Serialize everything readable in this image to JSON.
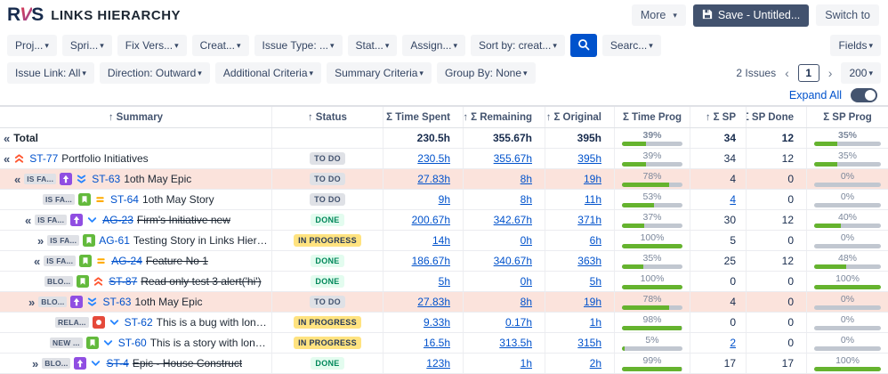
{
  "app": {
    "logo_left": "R",
    "logo_mid": "V",
    "logo_right": "S",
    "title": "Links Hierarchy"
  },
  "topbar": {
    "more_label": "More",
    "save_label": "Save - Untitled...",
    "switch_label": "Switch to"
  },
  "filter_bar": {
    "row1": [
      "Proj...",
      "Spri...",
      "Fix Vers...",
      "Creat...",
      "Issue Type: ...",
      "Stat...",
      "Assign...",
      "Sort by: creat..."
    ],
    "search_dropdown": "Searc...",
    "fields_label": "Fields",
    "row2": [
      "Issue Link: All",
      "Direction: Outward",
      "Additional Criteria",
      "Summary Criteria",
      "Group By: None"
    ],
    "issues_count": "2 Issues",
    "pager": {
      "prev": "‹",
      "page": "1",
      "next": "›",
      "page_size": "200"
    },
    "expand_all": "Expand All"
  },
  "colors": {
    "accent_blue": "#0052CC",
    "progress_green": "#65B32E",
    "progress_track": "#C1C7D0",
    "highlight_pink": "#FBE3DC"
  },
  "table": {
    "headers": [
      {
        "label": "Summary",
        "sort": true,
        "align": "a-center"
      },
      {
        "label": "Status",
        "sort": true,
        "align": "a-center"
      },
      {
        "label": "Σ Time Spent",
        "sort": true,
        "align": "a-right"
      },
      {
        "label": "Σ Remaining",
        "sort": true,
        "align": "a-right"
      },
      {
        "label": "Σ Original",
        "sort": true,
        "align": "a-right"
      },
      {
        "label": "Σ Time Prog",
        "sort": false,
        "align": "a-center"
      },
      {
        "label": "Σ SP",
        "sort": true,
        "align": "a-right-sm"
      },
      {
        "label": "Σ SP Done",
        "sort": true,
        "align": "a-right"
      },
      {
        "label": "Σ SP Prog",
        "sort": false,
        "align": "a-center"
      }
    ],
    "rows": [
      {
        "kind": "total",
        "arrow": "«",
        "summary": "Total",
        "time_spent": "230.5h",
        "remaining": "355.67h",
        "original": "395h",
        "time_prog": 39,
        "sp": "34",
        "sp_done": "12",
        "sp_prog": 35
      },
      {
        "arrow": "«",
        "indent": 4,
        "icons": [
          "highest"
        ],
        "key": "ST-77",
        "summary": "Portfolio Initiatives",
        "status": "TO DO",
        "status_kind": "todo",
        "time_spent": "230.5h",
        "remaining": "355.67h",
        "original": "395h",
        "time_prog": 39,
        "sp": "34",
        "sp_done": "12",
        "sp_prog": 35
      },
      {
        "arrow": "«",
        "indent": 16,
        "link_badge": "IS FA...",
        "icons": [
          "epic",
          "lowest"
        ],
        "key": "ST-63",
        "summary": "1oth May Epic",
        "status": "TO DO",
        "status_kind": "todo",
        "highlight": true,
        "time_spent": "27.83h",
        "remaining": "8h",
        "original": "19h",
        "time_prog": 78,
        "sp": "4",
        "sp_done": "0",
        "sp_prog": 0
      },
      {
        "indent": 48,
        "link_badge": "IS FA...",
        "icons": [
          "story",
          "medium"
        ],
        "key": "ST-64",
        "summary": "1oth May Story",
        "status": "TO DO",
        "status_kind": "todo",
        "time_spent": "9h",
        "remaining": "8h",
        "original": "11h",
        "time_prog": 53,
        "sp": "4",
        "sp_link": true,
        "sp_done": "0",
        "sp_prog": 0
      },
      {
        "arrow": "«",
        "indent": 28,
        "link_badge": "IS FA...",
        "icons": [
          "epic",
          "low"
        ],
        "key": "AG-23",
        "struck": true,
        "summary": "Firm's Initiative new",
        "status": "DONE",
        "status_kind": "done",
        "time_spent": "200.67h",
        "remaining": "342.67h",
        "original": "371h",
        "time_prog": 37,
        "sp": "30",
        "sp_done": "12",
        "sp_prog": 40
      },
      {
        "arrow": "»",
        "indent": 42,
        "link_badge": "IS FA...",
        "icons": [
          "story"
        ],
        "key": "AG-61",
        "summary": "Testing Story in Links Hierarc...",
        "status": "IN PROGRESS",
        "status_kind": "inprogress",
        "time_spent": "14h",
        "remaining": "0h",
        "original": "6h",
        "time_prog": 100,
        "sp": "5",
        "sp_done": "0",
        "sp_prog": 0
      },
      {
        "arrow": "«",
        "indent": 38,
        "link_badge": "IS FA...",
        "icons": [
          "story",
          "medium"
        ],
        "key": "AG-24",
        "struck": true,
        "summary": "Feature No 1",
        "status": "DONE",
        "status_kind": "done",
        "time_spent": "186.67h",
        "remaining": "340.67h",
        "original": "363h",
        "time_prog": 35,
        "sp": "25",
        "sp_done": "12",
        "sp_prog": 48
      },
      {
        "indent": 50,
        "link_badge": "BLO...",
        "icons": [
          "story",
          "highest"
        ],
        "key": "ST-87",
        "struck": true,
        "summary": "Read only test 3 alert('hi')",
        "status": "DONE",
        "status_kind": "done",
        "time_spent": "5h",
        "remaining": "0h",
        "original": "5h",
        "time_prog": 100,
        "sp": "0",
        "sp_done": "0",
        "sp_prog": 100
      },
      {
        "arrow": "»",
        "indent": 32,
        "link_badge": "BLO...",
        "icons": [
          "epic",
          "lowest"
        ],
        "key": "ST-63",
        "summary": "1oth May Epic",
        "status": "TO DO",
        "status_kind": "todo",
        "highlight": true,
        "time_spent": "27.83h",
        "remaining": "8h",
        "original": "19h",
        "time_prog": 78,
        "sp": "4",
        "sp_done": "0",
        "sp_prog": 0
      },
      {
        "indent": 62,
        "link_badge": "RELA...",
        "icons": [
          "bug",
          "low"
        ],
        "key": "ST-62",
        "summary": "This is a bug with long text ...",
        "status": "IN PROGRESS",
        "status_kind": "inprogress",
        "time_spent": "9.33h",
        "remaining": "0.17h",
        "original": "1h",
        "time_prog": 98,
        "sp": "0",
        "sp_done": "0",
        "sp_prog": 0
      },
      {
        "indent": 56,
        "link_badge": "NEW ...",
        "icons": [
          "story",
          "low"
        ],
        "key": "ST-60",
        "summary": "This is a story with long text...",
        "status": "IN PROGRESS",
        "status_kind": "inprogress",
        "time_spent": "16.5h",
        "remaining": "313.5h",
        "original": "315h",
        "time_prog": 5,
        "sp": "2",
        "sp_link": true,
        "sp_done": "0",
        "sp_prog": 0
      },
      {
        "arrow": "»",
        "indent": 36,
        "link_badge": "BLO...",
        "icons": [
          "epic",
          "low"
        ],
        "key": "ST-4",
        "struck": true,
        "summary": "Epic - House Construct",
        "status": "DONE",
        "status_kind": "done",
        "time_spent": "123h",
        "remaining": "1h",
        "original": "2h",
        "time_prog": 99,
        "sp": "17",
        "sp_done": "17",
        "sp_prog": 100
      }
    ]
  }
}
